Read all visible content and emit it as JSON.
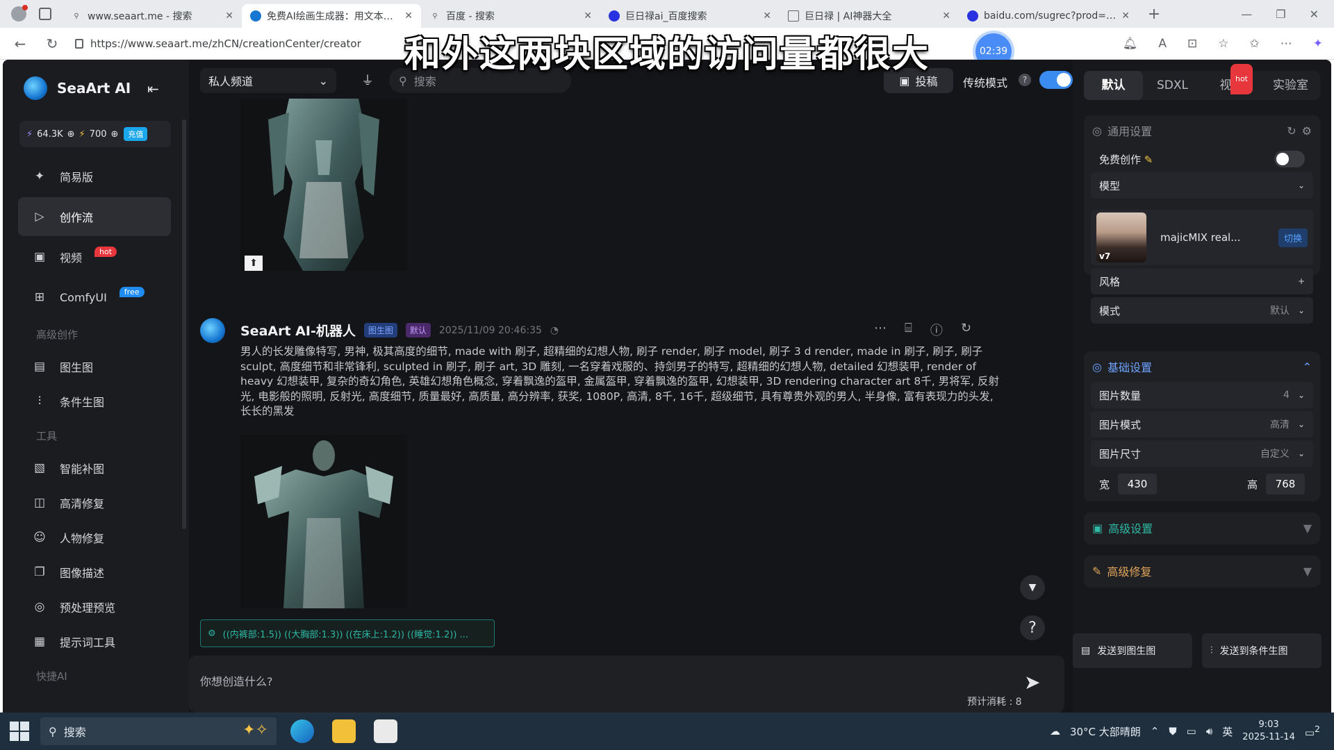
{
  "subtitle": "和外这两块区域的访问量都很大",
  "browser": {
    "tabs": [
      {
        "title": "www.seaart.me - 搜索",
        "icon": "search-icon"
      },
      {
        "title": "免费AI绘画生成器：用文本生成",
        "icon": "seaart-icon"
      },
      {
        "title": "百度 - 搜索",
        "icon": "search-icon"
      },
      {
        "title": "巨日禄ai_百度搜索",
        "icon": "baidu-icon"
      },
      {
        "title": "巨日禄 | AI神器大全",
        "icon": "page-icon"
      },
      {
        "title": "baidu.com/sugrec?prod=pc",
        "icon": "baidu-icon"
      }
    ],
    "url": "https://www.seaart.me/zhCN/creationCenter/creator",
    "timer": "02:39"
  },
  "sidebar": {
    "brand": "SeaArt AI",
    "credits_a": "64.3K",
    "credits_b": "700",
    "recharge": "充值",
    "items": [
      {
        "label": "简易版",
        "icon": "sparkle-icon"
      },
      {
        "label": "创作流",
        "icon": "play-icon"
      },
      {
        "label": "视频",
        "icon": "video-icon",
        "badge": "hot"
      },
      {
        "label": "ComfyUI",
        "icon": "comfy-icon",
        "badge": "free"
      }
    ],
    "section_advanced": "高级创作",
    "advanced": [
      {
        "label": "图生图",
        "icon": "image-icon"
      },
      {
        "label": "条件生图",
        "icon": "sliders-icon"
      }
    ],
    "section_tools": "工具",
    "tools": [
      {
        "label": "智能补图",
        "icon": "fill-icon"
      },
      {
        "label": "高清修复",
        "icon": "hd-icon"
      },
      {
        "label": "人物修复",
        "icon": "person-icon"
      },
      {
        "label": "图像描述",
        "icon": "book-icon"
      },
      {
        "label": "预处理预览",
        "icon": "preview-icon"
      },
      {
        "label": "提示词工具",
        "icon": "prompt-icon"
      }
    ],
    "section_quick": "快捷AI"
  },
  "center": {
    "channel": "私人频道",
    "search_placeholder": "搜索",
    "submit": "投稿",
    "mode_label": "传统模式",
    "message": {
      "bot_name": "SeaArt AI-机器人",
      "tag_a": "图生图",
      "tag_b": "默认",
      "timestamp": "2025/11/09 20:46:35",
      "prompt": "男人的长发雕像特写, 男神, 极其高度的细节, made with 刷子, 超精细的幻想人物, 刷子 render, 刷子 model, 刷子 3 d render, made in 刷子, 刷子, 刷子 sculpt, 高度细节和非常锋利, sculpted in 刷子, 刷子 art, 3D 雕刻, 一名穿着戏服的、持剑男子的特写, 超精细的幻想人物, detailed 幻想装甲, render of heavy 幻想装甲, 复杂的奇幻角色, 英雄幻想角色概念, 穿着飘逸的盔甲, 金属盔甲, 穿着飘逸的盔甲, 幻想装甲, 3D rendering character art 8千, 男将军, 反射光, 电影般的照明, 反射光, 高度细节, 质量最好, 高质量, 高分辨率, 获奖, 1080P, 高清, 8千, 16千, 超级细节, 具有尊贵外观的男人, 半身像, 富有表现力的头发, 长长的黑发"
    },
    "prompt_chip": "((内裤部:1.5)) ((大胸部:1.3)) ((在床上:1.2)) ((睡觉:1.2)) ...",
    "composer_placeholder": "你想创造什么?",
    "cost": "预计消耗 : 8"
  },
  "right": {
    "tabs": [
      "默认",
      "SDXL",
      "视频",
      "实验室"
    ],
    "tab_badge": "hot",
    "general_title": "通用设置",
    "free_create": "免费创作",
    "model_label": "模型",
    "model_name": "majicMIX real...",
    "model_version": "v7",
    "swap": "切换",
    "style_label": "风格",
    "mode_label": "模式",
    "mode_value": "默认",
    "basic_title": "基础设置",
    "count_label": "图片数量",
    "count_value": "4",
    "quality_label": "图片模式",
    "quality_value": "高清",
    "size_label": "图片尺寸",
    "size_value": "自定义",
    "width_label": "宽",
    "width_value": "430",
    "height_label": "高",
    "height_value": "768",
    "advanced_title": "高级设置",
    "fix_title": "高级修复",
    "send_img2img": "发送到图生图",
    "send_cond": "发送到条件生图"
  },
  "taskbar": {
    "search": "搜索",
    "weather": "30°C 大部晴朗",
    "ime": "英",
    "time": "9:03",
    "date": "2025-11-14",
    "notif_count": "2"
  }
}
